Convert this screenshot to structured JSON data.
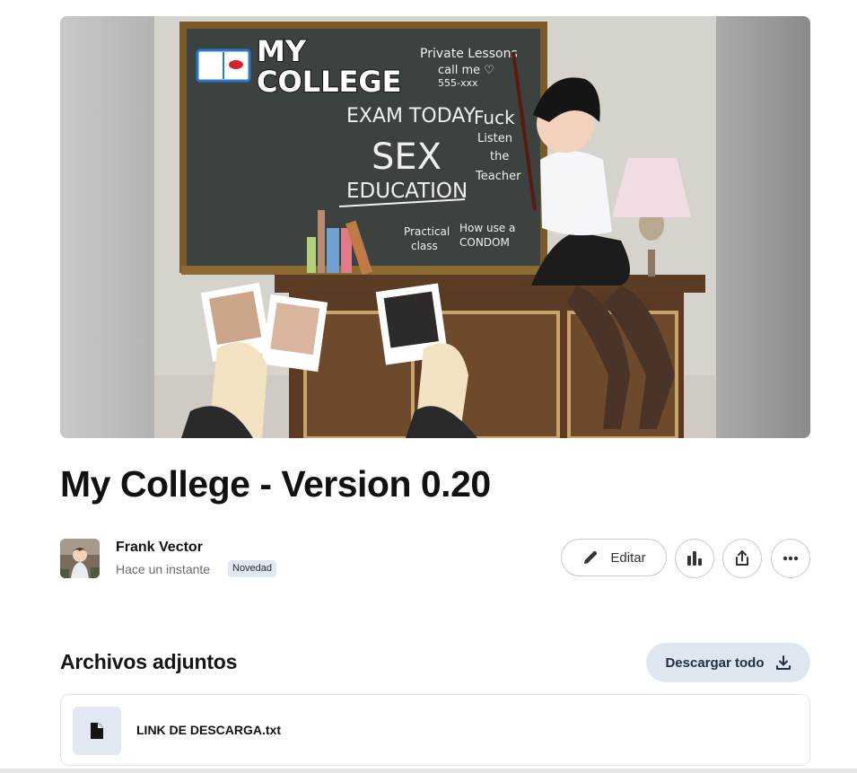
{
  "post": {
    "title": "My College - Version 0.20",
    "cover": {
      "logo_line1": "MY",
      "logo_line2": "COLLEGE",
      "board_text": {
        "private_1": "Private Lessons",
        "private_2": "call me ♡",
        "private_3": "555-xxx",
        "exam": "EXAM TODAY",
        "sex": "SEX",
        "education": "EDUCATION",
        "fuck_1": "Fuck",
        "fuck_2": "Listen",
        "fuck_3": "the",
        "fuck_4": "Teacher",
        "practical_1": "Practical",
        "practical_2": "class",
        "howuse_1": "How use a",
        "howuse_2": "CONDOM"
      }
    }
  },
  "author": {
    "name": "Frank Vector",
    "time": "Hace un instante",
    "badge": "Novedad"
  },
  "actions": {
    "edit_label": "Editar",
    "edit_icon": "pencil-icon",
    "stats_icon": "bar-chart-icon",
    "share_icon": "share-icon",
    "more_icon": "more-horizontal-icon"
  },
  "attachments": {
    "heading": "Archivos adjuntos",
    "download_all_label": "Descargar todo",
    "download_icon": "download-icon",
    "files": [
      {
        "name": "LINK DE DESCARGA.txt",
        "icon": "file-icon"
      }
    ]
  },
  "colors": {
    "badge_bg": "#e2e8f1",
    "download_bg": "#dee6f0",
    "text_primary": "#111111",
    "text_secondary": "#6b6b6b"
  }
}
